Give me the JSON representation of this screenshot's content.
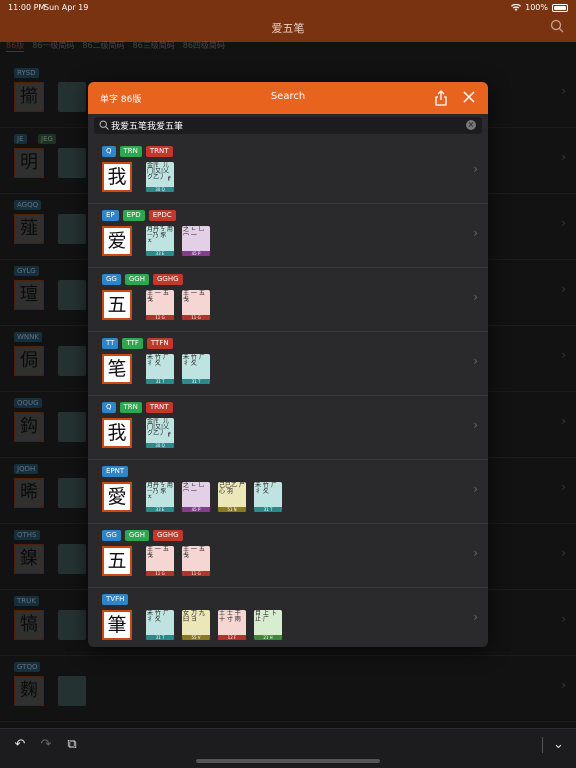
{
  "status": {
    "time": "11:00 PM",
    "date": "Sun Apr 19",
    "battery": "100%"
  },
  "nav": {
    "title": "爱五笔"
  },
  "bg_tabs": [
    "86版",
    "86一级简码",
    "86二级简码",
    "86三级简码",
    "86四级简码"
  ],
  "bg_rows": [
    {
      "codes": [
        "RYSD"
      ],
      "char": "擶"
    },
    {
      "codes": [
        "JE",
        "JEG"
      ],
      "char": "明"
    },
    {
      "codes": [
        "AGQQ"
      ],
      "char": "薤"
    },
    {
      "codes": [
        "GYLG"
      ],
      "char": "璮"
    },
    {
      "codes": [
        "WNNK"
      ],
      "char": "侷"
    },
    {
      "codes": [
        "QQUG"
      ],
      "char": "鈎"
    },
    {
      "codes": [
        "JQDH"
      ],
      "char": "晞"
    },
    {
      "codes": [
        "QTHS"
      ],
      "char": "鎳"
    },
    {
      "codes": [
        "TRUK"
      ],
      "char": "犒"
    },
    {
      "codes": [
        "GTQO"
      ],
      "char": "麴"
    }
  ],
  "modal": {
    "left_label": "单字  86版",
    "title": "Search",
    "search_value": "我爱五笔我爱五筆"
  },
  "entries": [
    {
      "codes": [
        [
          "Q",
          "blue"
        ],
        [
          "TRN",
          "green"
        ],
        [
          "TRNT",
          "red"
        ]
      ],
      "char": "我",
      "cards": [
        [
          "金|钅 儿 门|又|乂 ク乙丿 ┏",
          "teal",
          "30 Q"
        ]
      ]
    },
    {
      "codes": [
        [
          "EP",
          "blue"
        ],
        [
          "EPD",
          "green"
        ],
        [
          "EPDC",
          "red"
        ]
      ],
      "char": "爱",
      "cards": [
        [
          "月丹ㄋ 用ᅳ乃 豕 ㅊ",
          "teal",
          "33 E"
        ],
        [
          "之 ㄴ 乚 冖 一",
          "purple",
          "45 P"
        ]
      ]
    },
    {
      "codes": [
        [
          "GG",
          "blue"
        ],
        [
          "GGH",
          "green"
        ],
        [
          "GGHG",
          "red"
        ]
      ],
      "char": "五",
      "cards": [
        [
          "王 一 五 戋",
          "red",
          "11 G"
        ],
        [
          "王 一 五 戋",
          "red",
          "11 G"
        ]
      ]
    },
    {
      "codes": [
        [
          "TT",
          "blue"
        ],
        [
          "TTF",
          "green"
        ],
        [
          "TTFN",
          "red"
        ]
      ],
      "char": "笔",
      "cards": [
        [
          "禾 竹 ㄏ 彳 夂",
          "teal",
          "31 T"
        ],
        [
          "禾 竹 ㄏ 彳 夂",
          "teal",
          "31 T"
        ]
      ]
    },
    {
      "codes": [
        [
          "Q",
          "blue"
        ],
        [
          "TRN",
          "green"
        ],
        [
          "TRNT",
          "red"
        ]
      ],
      "char": "我",
      "cards": [
        [
          "金|钅 儿 门|又|乂 ク乙丿 ┏",
          "teal",
          "30 Q"
        ]
      ]
    },
    {
      "codes": [
        [
          "EPNT",
          "blue"
        ]
      ],
      "char": "愛",
      "cards": [
        [
          "月丹ㄋ 用ᅳ乃 豕 ㅊ",
          "teal",
          "33 E"
        ],
        [
          "之 ㄴ 乚 冖 一",
          "purple",
          "45 P"
        ],
        [
          "己巳乙 尸 心 羽",
          "olive",
          "51 N"
        ],
        [
          "禾 竹 ㄏ 彳 夂",
          "teal",
          "31 T"
        ]
      ]
    },
    {
      "codes": [
        [
          "GG",
          "blue"
        ],
        [
          "GGH",
          "green"
        ],
        [
          "GGHG",
          "red"
        ]
      ],
      "char": "五",
      "cards": [
        [
          "王 一 五 戋",
          "red",
          "11 G"
        ],
        [
          "王 一 五 戋",
          "red",
          "11 G"
        ]
      ]
    },
    {
      "codes": [
        [
          "TVFH",
          "blue"
        ]
      ],
      "char": "筆",
      "cards": [
        [
          "禾 竹 ㄏ 彳 夂",
          "teal",
          "31 T"
        ],
        [
          "女 刀 九 臼 ヨ",
          "olive",
          "55 V"
        ],
        [
          "土 士 干 十 寸 雨",
          "red",
          "12 F"
        ],
        [
          "目 上 卜 止 广",
          "green",
          "21 H"
        ]
      ]
    }
  ]
}
